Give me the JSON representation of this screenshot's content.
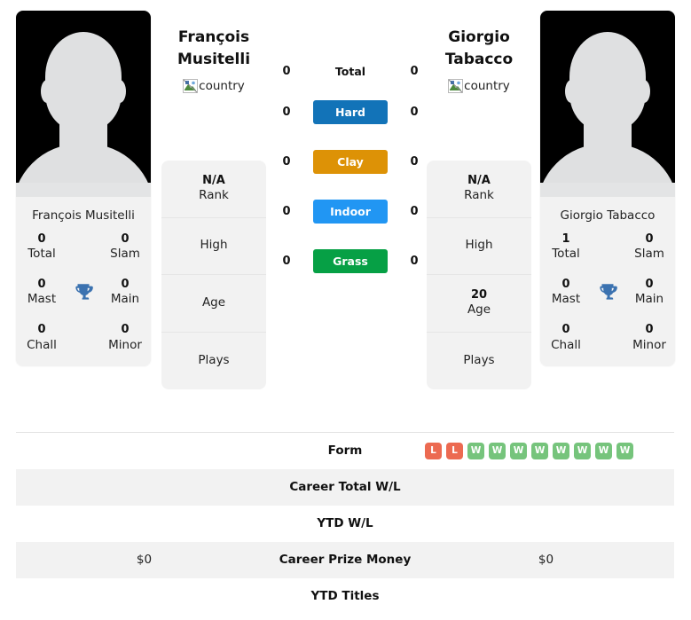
{
  "players": {
    "left": {
      "heading": "François Musitelli",
      "card_name": "François Musitelli",
      "country_alt": "country",
      "titles": {
        "total_num": "0",
        "total_label": "Total",
        "slam_num": "0",
        "slam_label": "Slam",
        "mast_num": "0",
        "mast_label": "Mast",
        "main_num": "0",
        "main_label": "Main",
        "chall_num": "0",
        "chall_label": "Chall",
        "minor_num": "0",
        "minor_label": "Minor"
      },
      "info": [
        {
          "value": "N/A",
          "label": "Rank"
        },
        {
          "value": "",
          "label": "High"
        },
        {
          "value": "",
          "label": "Age"
        },
        {
          "value": "",
          "label": "Plays"
        }
      ],
      "surface_wins": {
        "total": "0",
        "hard": "0",
        "clay": "0",
        "indoor": "0",
        "grass": "0"
      },
      "career_prize_money": "$0",
      "career_total_wl": "",
      "ytd_wl": "",
      "ytd_titles": "",
      "form": []
    },
    "right": {
      "heading": "Giorgio Tabacco",
      "card_name": "Giorgio Tabacco",
      "country_alt": "country",
      "titles": {
        "total_num": "1",
        "total_label": "Total",
        "slam_num": "0",
        "slam_label": "Slam",
        "mast_num": "0",
        "mast_label": "Mast",
        "main_num": "0",
        "main_label": "Main",
        "chall_num": "0",
        "chall_label": "Chall",
        "minor_num": "0",
        "minor_label": "Minor"
      },
      "info": [
        {
          "value": "N/A",
          "label": "Rank"
        },
        {
          "value": "",
          "label": "High"
        },
        {
          "value": "20",
          "label": "Age"
        },
        {
          "value": "",
          "label": "Plays"
        }
      ],
      "surface_wins": {
        "total": "0",
        "hard": "0",
        "clay": "0",
        "indoor": "0",
        "grass": "0"
      },
      "career_prize_money": "$0",
      "career_total_wl": "",
      "ytd_wl": "",
      "ytd_titles": "",
      "form": [
        {
          "result": "L",
          "color": "#ec6council"
        }
      ]
    }
  },
  "surfaces": [
    {
      "key": "total",
      "label": "Total",
      "color": "",
      "plain": true
    },
    {
      "key": "hard",
      "label": "Hard",
      "color": "#1273b8",
      "plain": false
    },
    {
      "key": "clay",
      "label": "Clay",
      "color": "#dd9206",
      "plain": false
    },
    {
      "key": "indoor",
      "label": "Indoor",
      "color": "#2196f3",
      "plain": false
    },
    {
      "key": "grass",
      "label": "Grass",
      "color": "#06a045",
      "plain": false
    }
  ],
  "table_rows": [
    {
      "label": "Form",
      "left": "",
      "right": ""
    },
    {
      "label": "Career Total W/L",
      "left": "",
      "right": ""
    },
    {
      "label": "YTD W/L",
      "left": "",
      "right": ""
    },
    {
      "label": "Career Prize Money",
      "left": "$0",
      "right": "$0"
    },
    {
      "label": "YTD Titles",
      "left": "",
      "right": ""
    }
  ],
  "form_right": [
    {
      "result": "L"
    },
    {
      "result": "L"
    },
    {
      "result": "W"
    },
    {
      "result": "W"
    },
    {
      "result": "W"
    },
    {
      "result": "W"
    },
    {
      "result": "W"
    },
    {
      "result": "W"
    },
    {
      "result": "W"
    },
    {
      "result": "W"
    }
  ],
  "colors": {
    "win": "#76c47c",
    "loss": "#ec6css",
    "loss_red": "#ec6a51",
    "trophy": "#3b72b0",
    "card_bg": "#f2f2f2",
    "row_stripe": "#f2f2f2"
  },
  "icons": {
    "trophy": "trophy-icon",
    "broken_image": "broken-image-icon"
  }
}
